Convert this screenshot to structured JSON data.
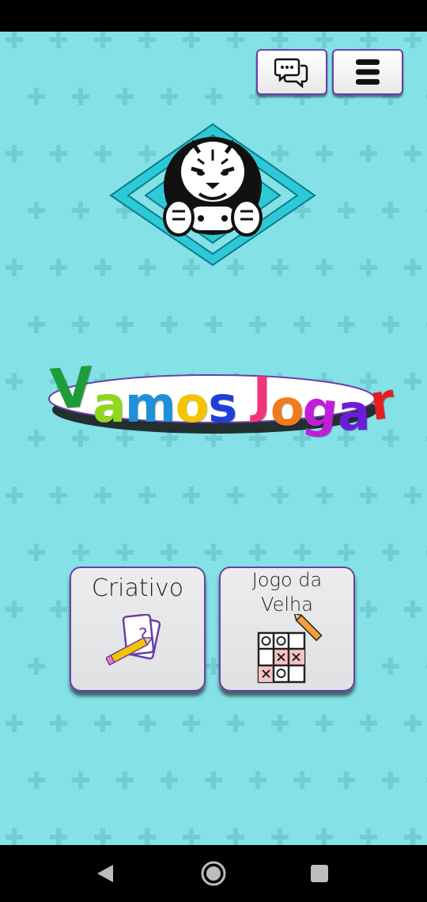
{
  "app": {
    "background_color": "#84e1e5",
    "accent_border_color": "#6a3fa8"
  },
  "header": {
    "chat_button": {
      "icon": "chat-bubbles-icon"
    },
    "menu_button": {
      "icon": "hamburger-menu-icon"
    }
  },
  "logo": {
    "icon": "tiger-gamer-logo"
  },
  "title": {
    "text": "Vamos Jogar",
    "letters": [
      {
        "char": "V",
        "color": "#1e9c3a"
      },
      {
        "char": "a",
        "color": "#8fd81e"
      },
      {
        "char": "m",
        "color": "#1e8fd8"
      },
      {
        "char": "o",
        "color": "#f5c400"
      },
      {
        "char": "s",
        "color": "#1e3fd8"
      },
      {
        "char": " ",
        "color": "#000000"
      },
      {
        "char": "J",
        "color": "#f0357a"
      },
      {
        "char": "o",
        "color": "#f07a1e"
      },
      {
        "char": "g",
        "color": "#c01ed8"
      },
      {
        "char": "a",
        "color": "#6a1ed8"
      },
      {
        "char": "r",
        "color": "#e81e1e"
      }
    ]
  },
  "games": [
    {
      "label": "Criativo",
      "icon": "pencil-cards-icon"
    },
    {
      "label_line1": "Jogo da",
      "label_line2": "Velha",
      "icon": "tic-tac-toe-grid-icon"
    }
  ],
  "nav": {
    "back": {
      "icon": "back-triangle-icon"
    },
    "home": {
      "icon": "home-circle-icon"
    },
    "recents": {
      "icon": "recents-square-icon"
    }
  }
}
